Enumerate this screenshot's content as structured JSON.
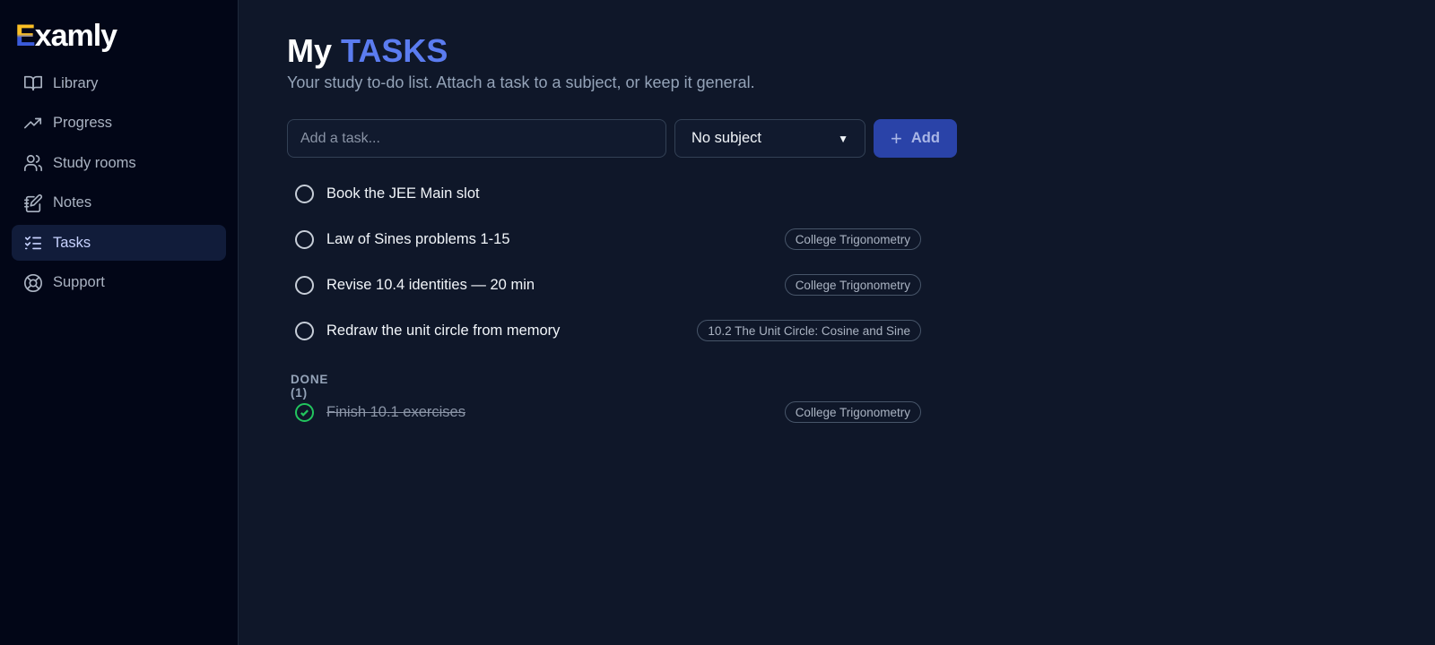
{
  "app": {
    "logo_e": "E",
    "logo_rest": "xamly"
  },
  "sidebar": {
    "items": [
      {
        "label": "Library",
        "icon": "book-open-icon",
        "active": false
      },
      {
        "label": "Progress",
        "icon": "trending-up-icon",
        "active": false
      },
      {
        "label": "Study rooms",
        "icon": "users-icon",
        "active": false
      },
      {
        "label": "Notes",
        "icon": "notebook-pen-icon",
        "active": false
      },
      {
        "label": "Tasks",
        "icon": "list-checks-icon",
        "active": true
      },
      {
        "label": "Support",
        "icon": "life-buoy-icon",
        "active": false
      }
    ]
  },
  "page": {
    "title_plain": "My",
    "title_accent": "TASKS",
    "subtitle": "Your study to-do list. Attach a task to a subject, or keep it general."
  },
  "form": {
    "task_placeholder": "Add a task...",
    "task_value": "",
    "subject_selected": "No subject",
    "add_label": "Add"
  },
  "tasks": [
    {
      "text": "Book the JEE Main slot",
      "tag": ""
    },
    {
      "text": "Law of Sines problems 1-15",
      "tag": "College Trigonometry"
    },
    {
      "text": "Revise 10.4 identities — 20 min",
      "tag": "College Trigonometry"
    },
    {
      "text": "Redraw the unit circle from memory",
      "tag": "10.2 The Unit Circle: Cosine and Sine"
    }
  ],
  "done": {
    "header": "DONE (1)",
    "items": [
      {
        "text": "Finish 10.1 exercises",
        "tag": "College Trigonometry"
      }
    ]
  },
  "colors": {
    "background": "#0f1729",
    "sidebar": "#020617",
    "accent": "#5b7cf0",
    "button": "#2a43a8",
    "done_check": "#22c55e"
  }
}
